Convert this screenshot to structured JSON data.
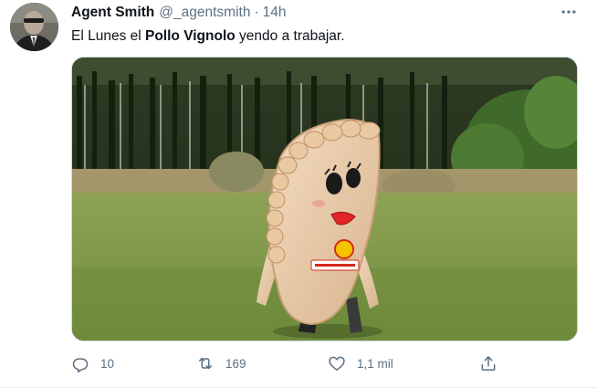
{
  "tweet": {
    "author_name": "Agent Smith",
    "handle": "@_agentsmith",
    "separator": "·",
    "time": "14h",
    "text_before": "El Lunes el ",
    "text_bold": "Pollo Vignolo",
    "text_after": " yendo a trabajar.",
    "media_alt": "Person in an empanada mascot costume walking across a grassy field with trees behind"
  },
  "actions": {
    "replies": "10",
    "retweets": "169",
    "likes": "1,1 mil"
  },
  "icons": {
    "more": "more-icon",
    "reply": "reply-icon",
    "retweet": "retweet-icon",
    "like": "heart-icon",
    "share": "share-icon"
  },
  "colors": {
    "text": "#0f1419",
    "secondary": "#5b7083",
    "border": "#cfd9de"
  }
}
